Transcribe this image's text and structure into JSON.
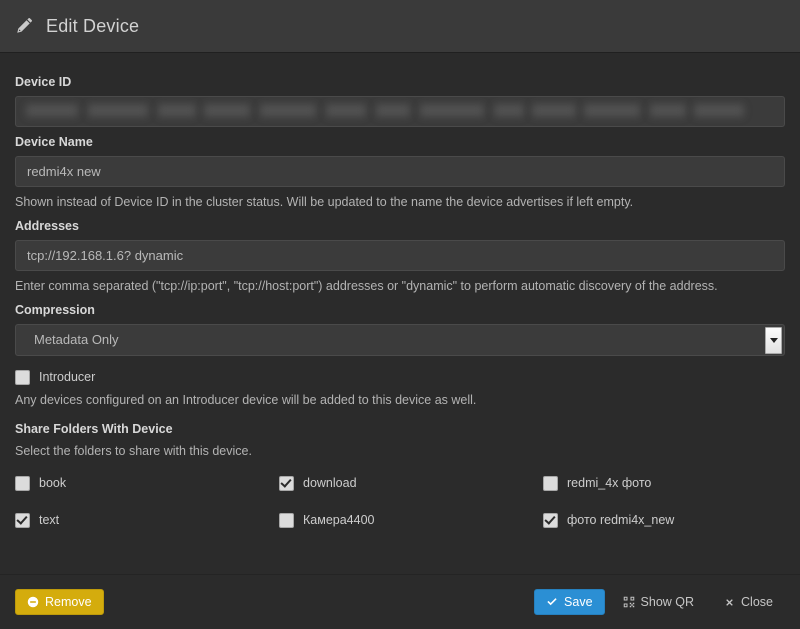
{
  "header": {
    "title": "Edit Device",
    "icon": "pencil-icon"
  },
  "fields": {
    "device_id": {
      "label": "Device ID",
      "value": "",
      "redacted": true
    },
    "device_name": {
      "label": "Device Name",
      "value": "redmi4x new",
      "help": "Shown instead of Device ID in the cluster status. Will be updated to the name the device advertises if left empty."
    },
    "addresses": {
      "label": "Addresses",
      "value": "tcp://192.168.1.6? dynamic",
      "help": "Enter comma separated (\"tcp://ip:port\", \"tcp://host:port\") addresses or \"dynamic\" to perform automatic discovery of the address."
    },
    "compression": {
      "label": "Compression",
      "value": "Metadata Only",
      "options": [
        "Metadata Only"
      ]
    },
    "introducer": {
      "label": "Introducer",
      "checked": false,
      "help": "Any devices configured on an Introducer device will be added to this device as well."
    }
  },
  "share_folders": {
    "title": "Share Folders With Device",
    "help": "Select the folders to share with this device.",
    "items": [
      {
        "label": "book",
        "checked": false
      },
      {
        "label": "download",
        "checked": true
      },
      {
        "label": "redmi_4x фото",
        "checked": false
      },
      {
        "label": "text",
        "checked": true
      },
      {
        "label": "Камера4400",
        "checked": false
      },
      {
        "label": "фото redmi4x_new",
        "checked": true
      }
    ]
  },
  "footer": {
    "remove_label": "Remove",
    "save_label": "Save",
    "show_qr_label": "Show QR",
    "close_label": "Close"
  },
  "colors": {
    "remove": "#d4ac0d",
    "save": "#2b8fd4",
    "modal_bg": "#2b2b2b",
    "header_bg": "#3a3a3a",
    "input_bg": "#3b3b3b"
  }
}
